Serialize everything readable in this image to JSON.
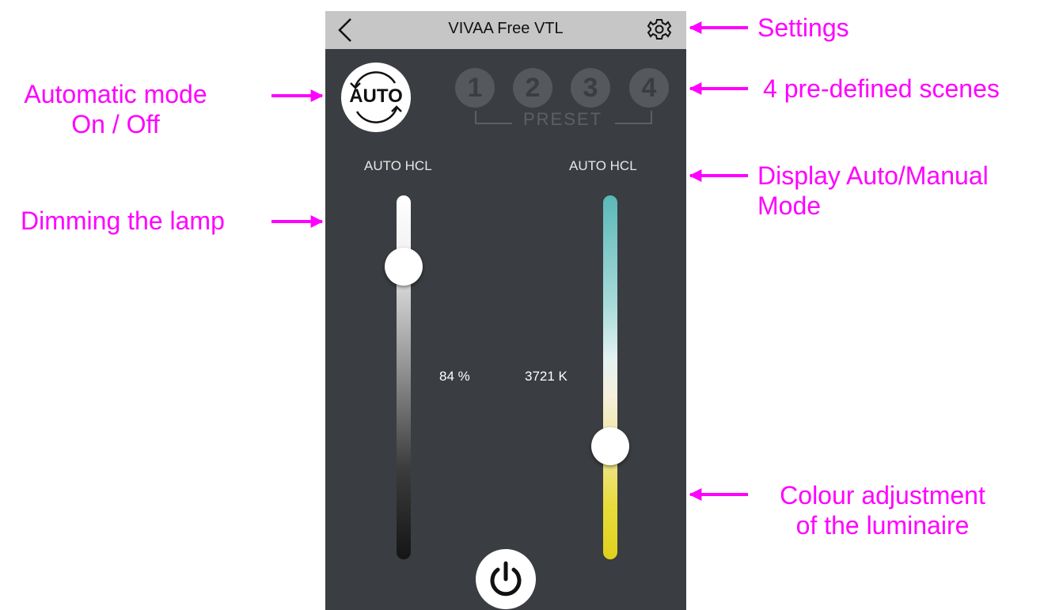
{
  "app": {
    "title": "VIVAA Free VTL",
    "auto_button_label": "AUTO",
    "presets": [
      "1",
      "2",
      "3",
      "4"
    ],
    "preset_label": "PRESET",
    "mode_left": "AUTO HCL",
    "mode_right": "AUTO HCL",
    "dimming_value": "84 %",
    "colour_value": "3721 K",
    "dimming_level_percent": 84,
    "colour_level_fraction": 0.71
  },
  "annotations": {
    "settings": "Settings",
    "auto_mode_line1": "Automatic mode",
    "auto_mode_line2": "On / Off",
    "scenes": "4 pre-defined scenes",
    "display_mode_line1": "Display Auto/Manual",
    "display_mode_line2": "Mode",
    "dimming": "Dimming the lamp",
    "colour_line1": "Colour adjustment",
    "colour_line2": "of the luminaire"
  },
  "colors": {
    "annotation": "#ff00ff",
    "phone_background": "#3a3d41",
    "top_bar": "#c6c6c6"
  },
  "icons": [
    "back-chevron-icon",
    "gear-icon",
    "auto-cycle-icon",
    "power-icon"
  ]
}
